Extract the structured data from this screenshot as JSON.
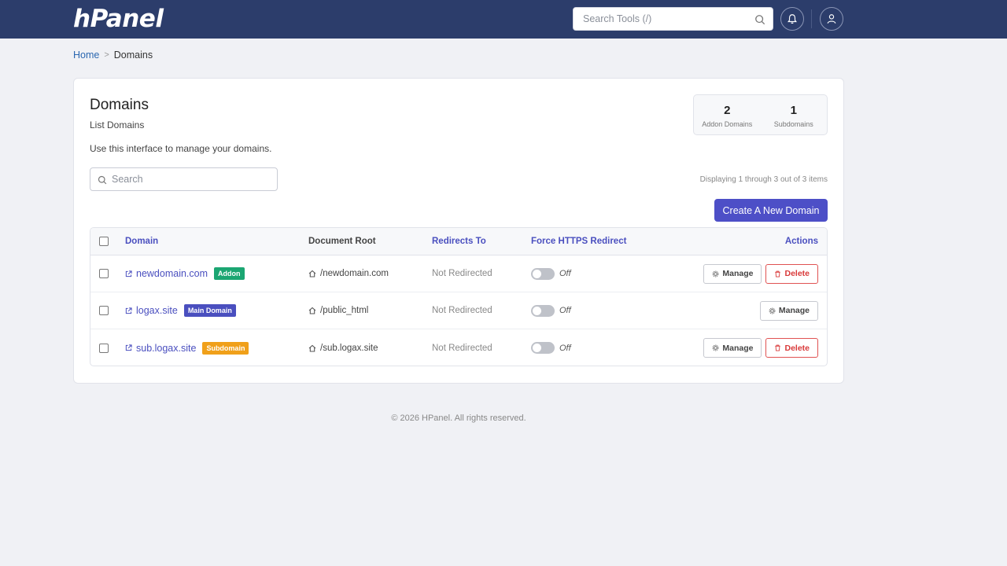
{
  "brand": {
    "logo_text": "hPanel"
  },
  "header": {
    "search_placeholder": "Search Tools (/)",
    "icons": [
      "search-icon",
      "bell-icon",
      "user-icon"
    ]
  },
  "breadcrumb": {
    "home": "Home",
    "separator": ">",
    "current": "Domains"
  },
  "page": {
    "title": "Domains",
    "subtitle": "List Domains",
    "description": "Use this interface to manage your domains."
  },
  "stats": [
    {
      "value": "2",
      "label": "Addon Domains"
    },
    {
      "value": "1",
      "label": "Subdomains"
    }
  ],
  "search": {
    "placeholder": "Search"
  },
  "display_info": "Displaying 1 through 3 out of 3 items",
  "create_button": "Create A New Domain",
  "table": {
    "headers": {
      "domain": "Domain",
      "root": "Document Root",
      "redirect": "Redirects To",
      "https": "Force HTTPS Redirect",
      "actions": "Actions"
    },
    "rows": [
      {
        "domain": "newdomain.com",
        "badge": "Addon",
        "badge_color": "#1ba672",
        "root": "/newdomain.com",
        "redirect": "Not Redirected",
        "https": "Off",
        "manage": "Manage",
        "delete": "Delete"
      },
      {
        "domain": "logax.site",
        "badge": "Main Domain",
        "badge_color": "#4a4fbf",
        "root": "/public_html",
        "redirect": "Not Redirected",
        "https": "Off",
        "manage": "Manage"
      },
      {
        "domain": "sub.logax.site",
        "badge": "Subdomain",
        "badge_color": "#f0a01a",
        "root": "/sub.logax.site",
        "redirect": "Not Redirected",
        "https": "Off",
        "manage": "Manage",
        "delete": "Delete"
      }
    ]
  },
  "footer": "© 2026 HPanel. All rights reserved.",
  "colors": {
    "topbar": "#2c3d6b",
    "accent": "#4d4fc7",
    "danger": "#d93a3a",
    "background": "#f0f1f5"
  }
}
